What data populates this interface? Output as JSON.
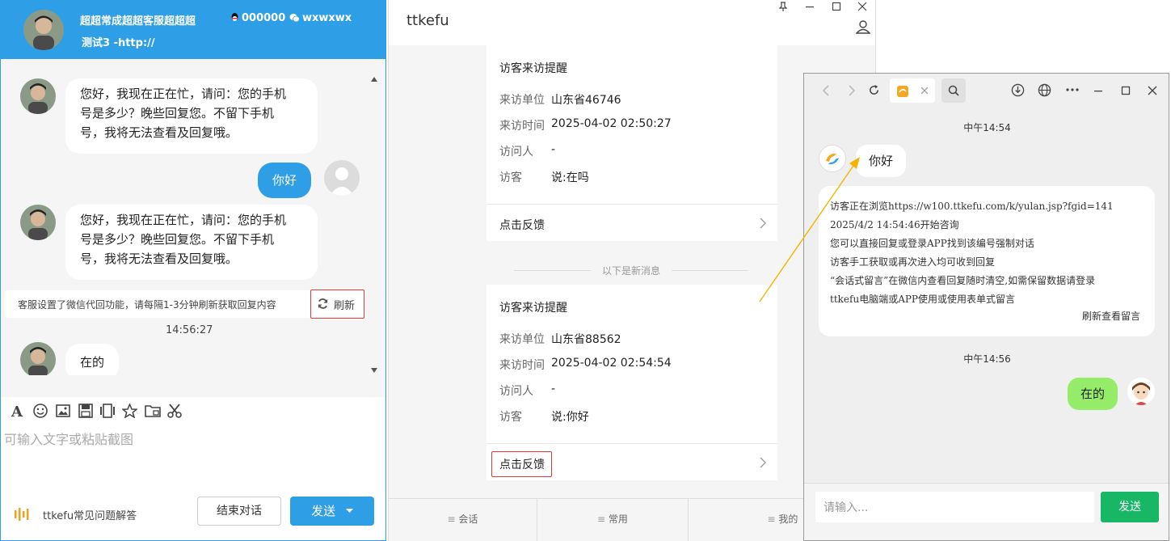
{
  "agent": {
    "name": "超超常成超超客服超超超",
    "qq": "000000",
    "wechat": "wxwxwx",
    "subtitle": "测试3 -http://"
  },
  "agent_chat": {
    "messages": [
      {
        "from": "agent",
        "text_lines": [
          "您好，我现在正在忙，请问：您的手机",
          "号是多少？晚些回复您。不留下手机",
          "号，我将无法查看及回复哦。"
        ]
      },
      {
        "from": "visitor",
        "text": "你好"
      },
      {
        "from": "agent",
        "text_lines": [
          "您好，我现在正在忙，请问：您的手机",
          "号是多少？晚些回复您。不留下手机",
          "号，我将无法查看及回复哦。"
        ]
      },
      {
        "from": "agent",
        "text": "在的"
      }
    ],
    "notice": "客服设置了微信代回功能，请每隔1-3分钟刷新获取回复内容",
    "refresh_label": "刷新",
    "time": "14:56:27",
    "input_placeholder": "可输入文字或粘贴截图",
    "faq_label": "ttkefu常见问题解答",
    "end_label": "结束对话",
    "send_label": "发送"
  },
  "ttkefu": {
    "title": "ttkefu",
    "cards": [
      {
        "title": "访客来访提醒",
        "rows": [
          {
            "label": "来访单位",
            "value": "山东省46746"
          },
          {
            "label": "来访时间",
            "value": "2025-04-02 02:50:27"
          },
          {
            "label": "访问人",
            "value": "-"
          },
          {
            "label": "访客",
            "value": "说:在吗"
          }
        ],
        "feedback": "点击反馈"
      },
      {
        "title": "访客来访提醒",
        "rows": [
          {
            "label": "来访单位",
            "value": "山东省88562"
          },
          {
            "label": "来访时间",
            "value": "2025-04-02 02:54:54"
          },
          {
            "label": "访问人",
            "value": "-"
          },
          {
            "label": "访客",
            "value": "说:你好"
          }
        ],
        "feedback": "点击反馈"
      }
    ],
    "new_message_divider": "以下是新消息",
    "tabs": [
      "会话",
      "常用",
      "我的"
    ]
  },
  "visitor": {
    "time1": "中午14:54",
    "greeting": "你好",
    "info_lines": [
      "访客正在浏览https://w100.ttkefu.com/k/yulan.jsp?fgid=141",
      "2025/4/2 14:54:46开始咨询",
      "您可以直接回复或登录APP找到该编号强制对话",
      "访客手工获取或再次进入均可收到回复",
      "“会话式留言”在微信内查看回复随时清空,如需保留数据请登录",
      "ttkefu电脑端或APP使用或使用表单式留言"
    ],
    "refresh_link": "刷新查看留言",
    "time2": "中午14:56",
    "reply": "在的",
    "input_placeholder": "请输入...",
    "send_label": "发送"
  },
  "colors": {
    "accent_blue": "#2e9fe6",
    "accent_green": "#18b766",
    "highlight_red": "#e53935",
    "arrow_orange": "#f5b400"
  }
}
